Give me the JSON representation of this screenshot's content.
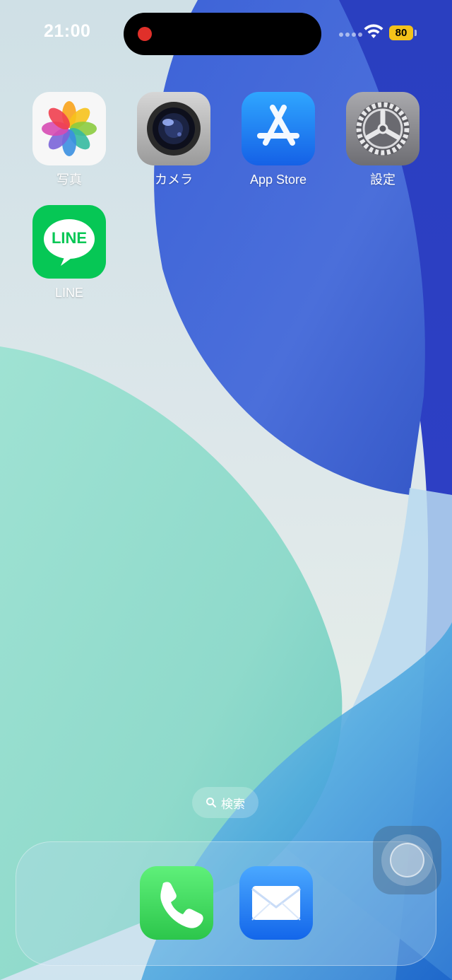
{
  "status_bar": {
    "time": "21:00",
    "battery_level": "80",
    "wifi_icon": "wifi-icon",
    "recording_indicator_color": "#e0302a",
    "battery_color": "#f4c21a"
  },
  "apps": [
    {
      "label": "写真",
      "icon": "photos-icon"
    },
    {
      "label": "カメラ",
      "icon": "camera-icon"
    },
    {
      "label": "App Store",
      "icon": "app-store-icon"
    },
    {
      "label": "設定",
      "icon": "settings-icon"
    },
    {
      "label": "LINE",
      "icon": "line-icon",
      "icon_text": "LINE",
      "brand_color": "#06c755"
    }
  ],
  "search": {
    "label": "検索",
    "icon": "search-icon"
  },
  "dock": {
    "apps": [
      {
        "name": "phone",
        "icon": "phone-icon",
        "brand_color": "#34c759"
      },
      {
        "name": "mail",
        "icon": "mail-icon",
        "brand_color": "#1a7cf5"
      }
    ]
  }
}
